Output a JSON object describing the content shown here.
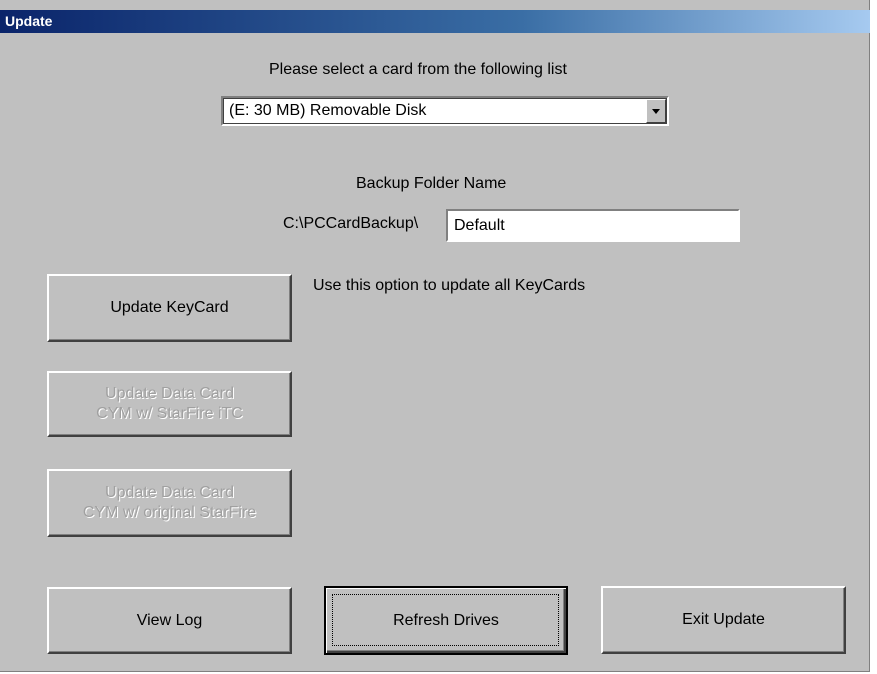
{
  "window": {
    "title": "Update"
  },
  "card_select": {
    "prompt": "Please select a card from the following list",
    "selected": "(E: 30 MB) Removable Disk"
  },
  "backup": {
    "label": "Backup Folder Name",
    "prefix": "C:\\PCCardBackup\\",
    "value": "Default"
  },
  "buttons": {
    "update_keycard": "Update KeyCard",
    "update_keycard_hint": "Use this option to update all KeyCards",
    "update_itc_line1": "Update Data Card",
    "update_itc_line2": "CYM w/ StarFire iTC",
    "update_original_line1": "Update Data Card",
    "update_original_line2": "CYM w/ original StarFire",
    "view_log": "View Log",
    "refresh_drives": "Refresh Drives",
    "exit_update": "Exit Update"
  },
  "icons": {
    "dropdown": "chevron-down-icon"
  }
}
